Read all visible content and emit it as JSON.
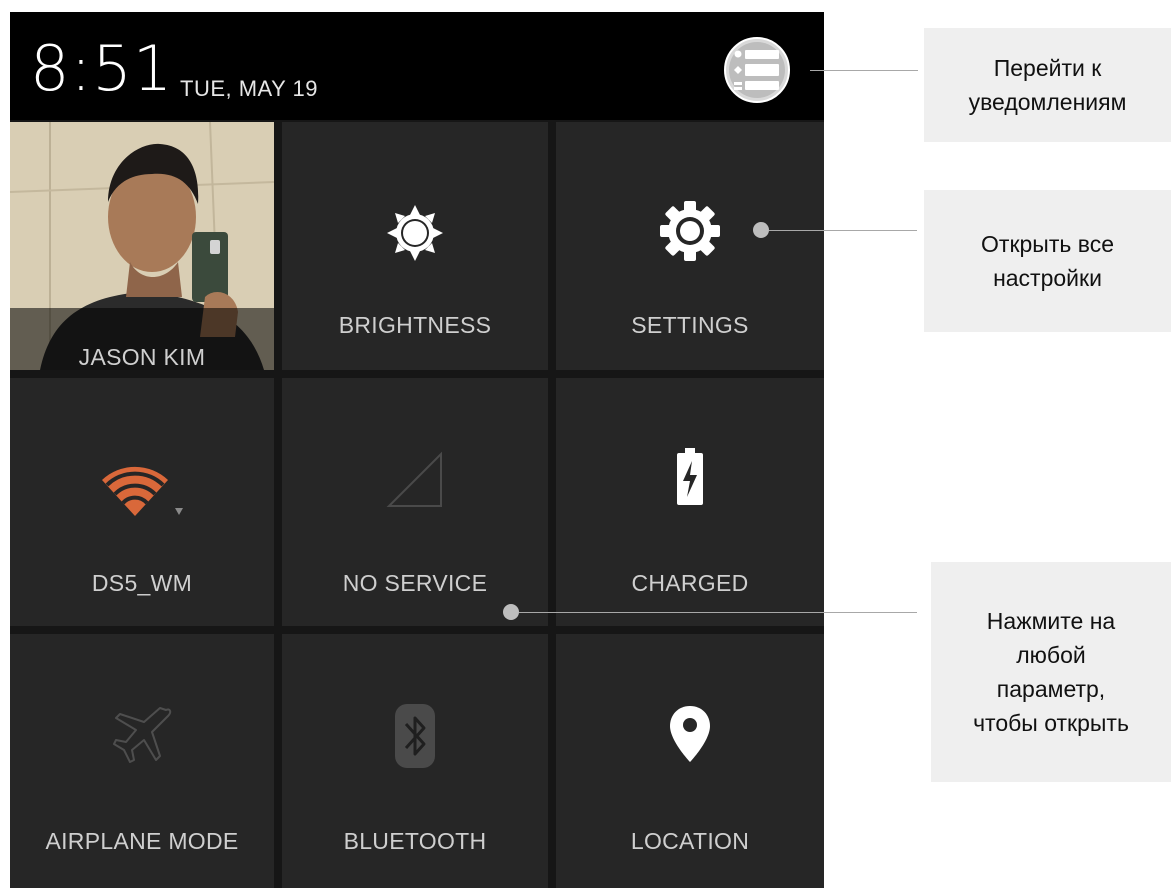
{
  "status_bar": {
    "time": "8:51",
    "date": "TUE, MAY 19",
    "notifications_icon": "notifications-list-icon"
  },
  "tiles": {
    "user": {
      "label": "JASON KIM",
      "icon": "user-avatar-photo"
    },
    "brightness": {
      "label": "BRIGHTNESS",
      "icon": "brightness-sun-icon"
    },
    "settings": {
      "label": "SETTINGS",
      "icon": "settings-gear-icon"
    },
    "wifi": {
      "label": "DS5_WM",
      "icon": "wifi-icon"
    },
    "mobile": {
      "label": "NO SERVICE",
      "icon": "signal-icon"
    },
    "battery": {
      "label": "CHARGED",
      "icon": "battery-charging-icon"
    },
    "airplane": {
      "label": "AIRPLANE MODE",
      "icon": "airplane-icon"
    },
    "bluetooth": {
      "label": "BLUETOOTH",
      "icon": "bluetooth-icon"
    },
    "location": {
      "label": "LOCATION",
      "icon": "location-pin-icon"
    }
  },
  "callouts": {
    "notifications": [
      "Перейти к",
      "уведомлениям"
    ],
    "settings": [
      "Открыть все",
      "настройки"
    ],
    "tap_any": [
      "Нажмите на",
      "любой",
      "параметр,",
      "чтобы открыть"
    ]
  },
  "colors": {
    "panel_bg": "#161616",
    "tile_bg": "#262626",
    "status_bar_bg": "#000000",
    "wifi_accent": "#d9683a",
    "label_text": "#cfcfcf",
    "callout_bg": "#efefef"
  }
}
